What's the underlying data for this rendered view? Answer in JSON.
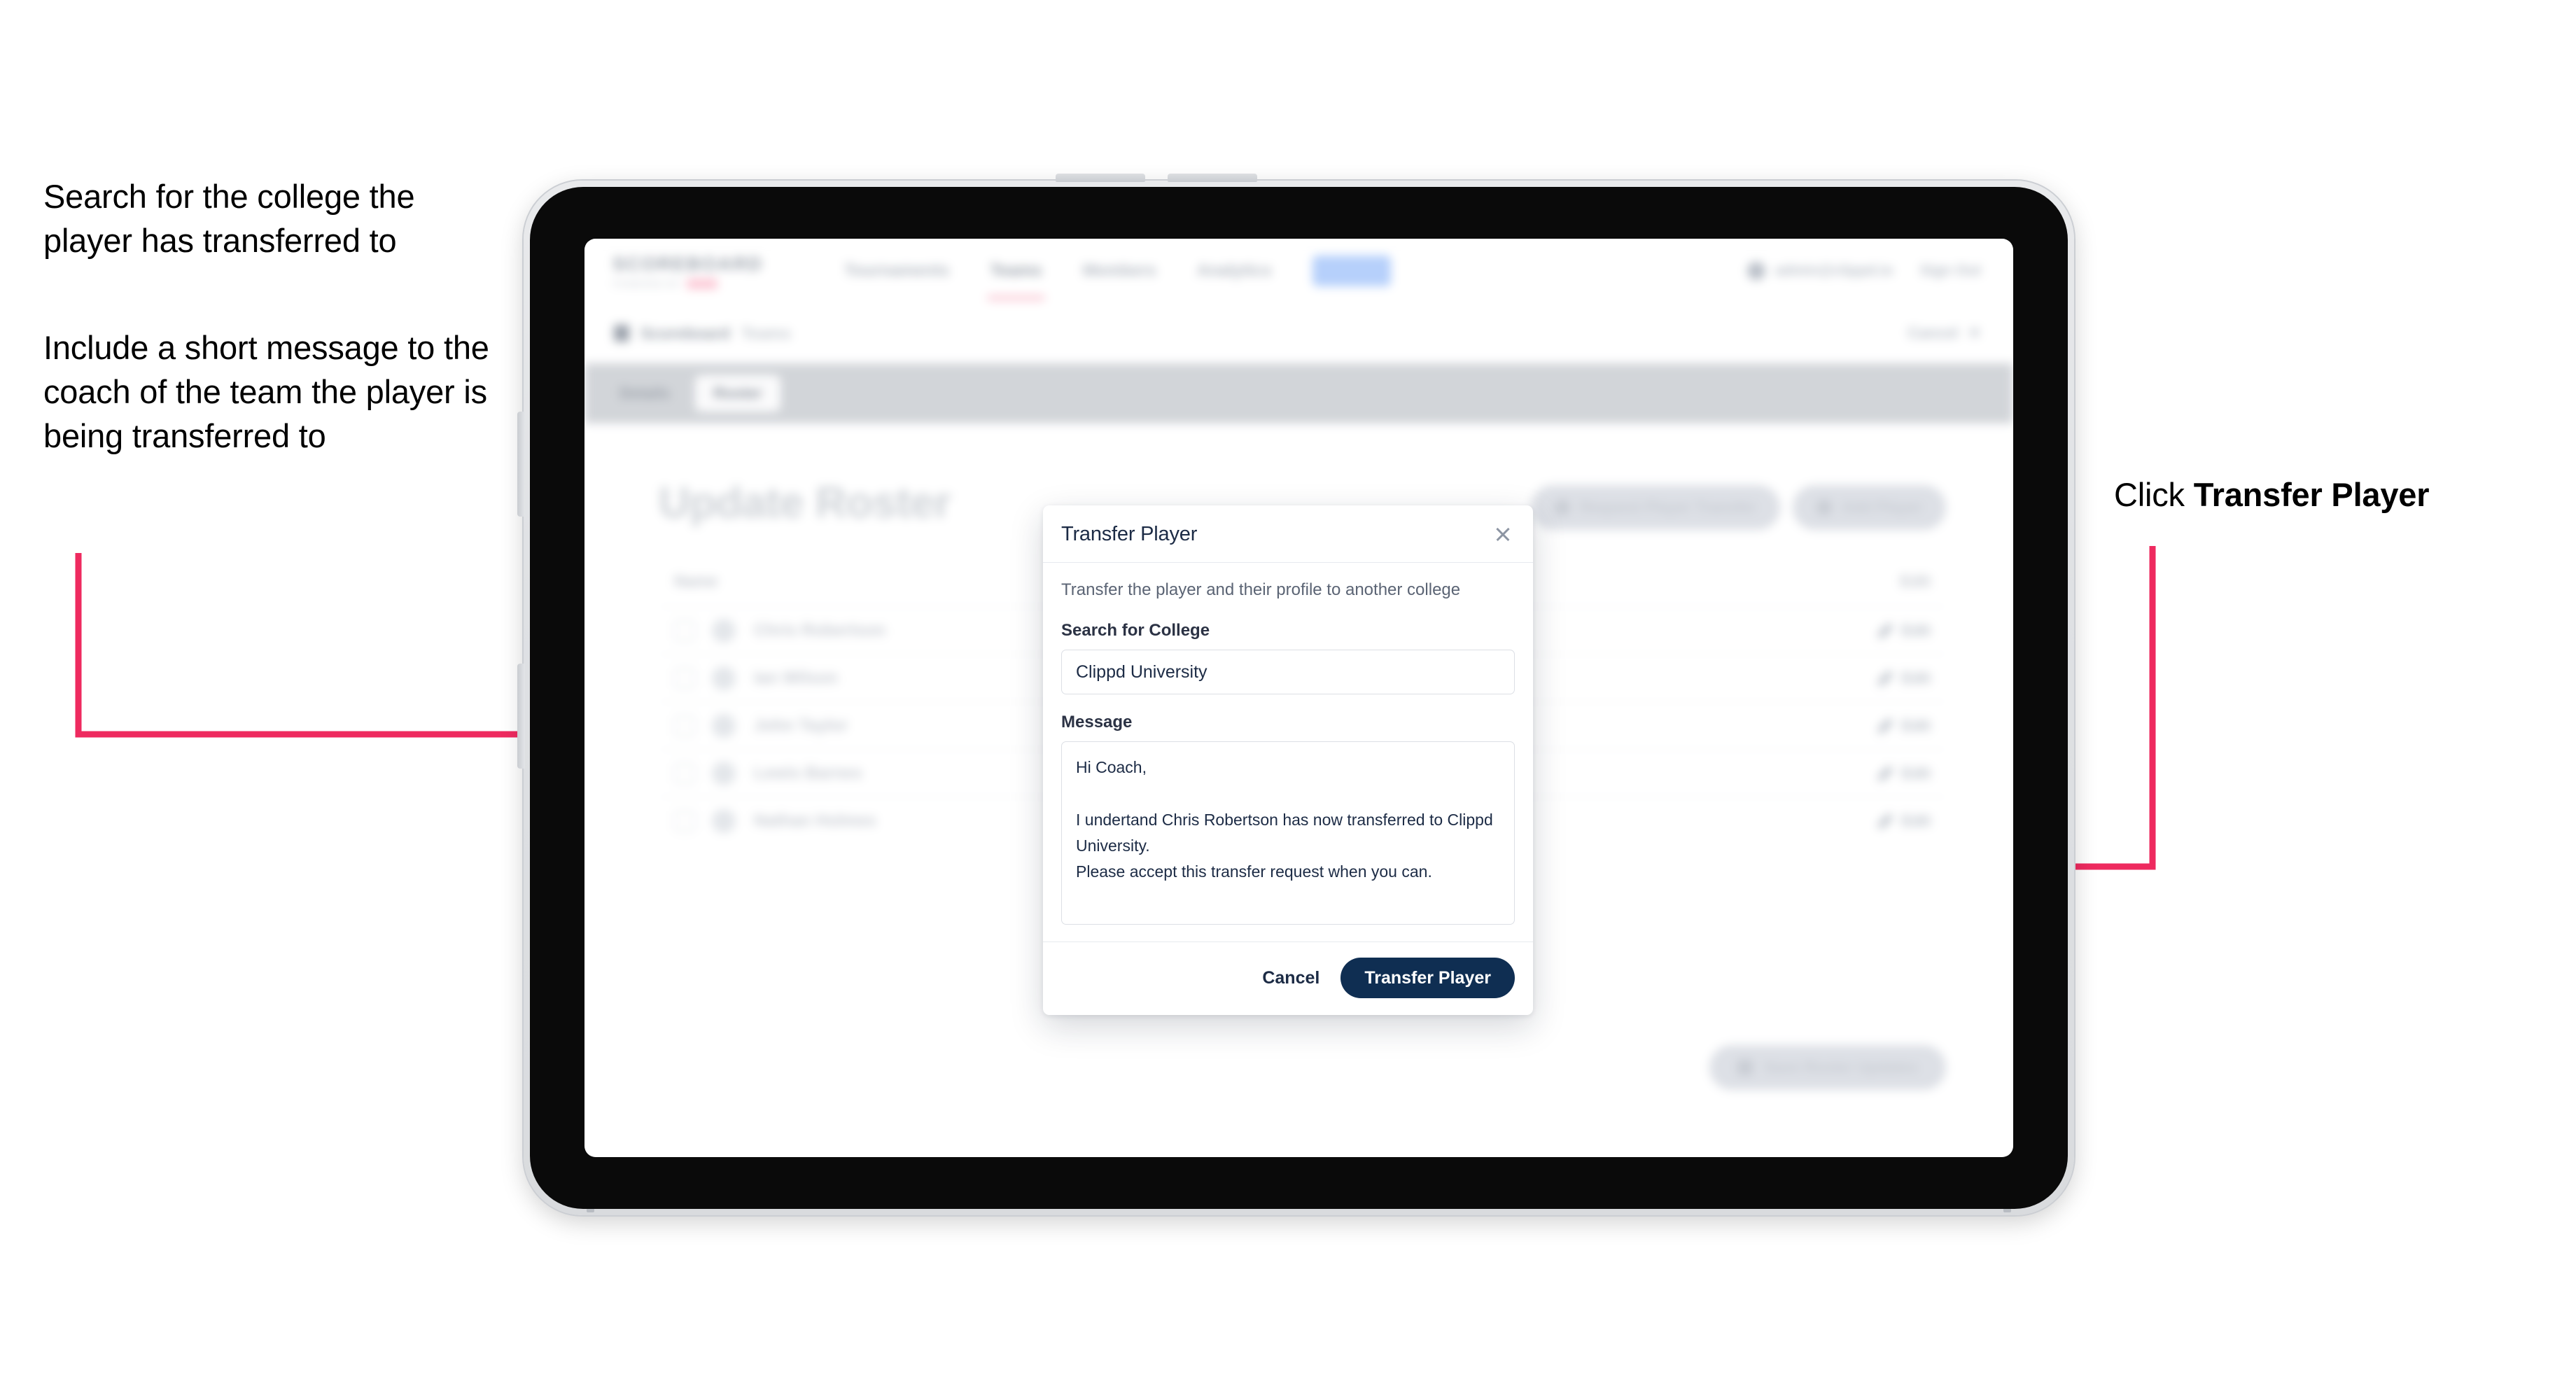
{
  "annotations": {
    "left_top": "Search for the college the player has transferred to",
    "left_bottom": "Include a short message to the coach of the team the player is being transferred to",
    "right_prefix": "Click ",
    "right_bold": "Transfer Player",
    "arrow_color": "#EE2A5F"
  },
  "app": {
    "logo": {
      "word": "SCOREBOARD",
      "sub": "POWERED BY"
    },
    "nav": [
      {
        "label": "Tournaments",
        "state": "normal"
      },
      {
        "label": "Teams",
        "state": "active"
      },
      {
        "label": "Members",
        "state": "normal"
      },
      {
        "label": "Analytics",
        "state": "normal"
      },
      {
        "label": "Admin",
        "state": "pill"
      }
    ],
    "nav_right": {
      "account": "admin@clippd.io",
      "signout": "Sign Out"
    },
    "breadcrumb": {
      "primary": "Scoreboard",
      "secondary": "Teams"
    },
    "subbar_right": "Cancel",
    "tabs": [
      {
        "label": "Details",
        "selected": false
      },
      {
        "label": "Roster",
        "selected": true
      }
    ],
    "page_title": "Update Roster",
    "action_buttons": [
      {
        "label": "Request Player Transfer",
        "icon": "transfer-icon"
      },
      {
        "label": "Add Player",
        "icon": "plus-icon"
      }
    ],
    "list_headers": {
      "name": "Name",
      "action": "Edit"
    },
    "players": [
      {
        "name": "Chris Robertson",
        "edit": "Edit"
      },
      {
        "name": "Ian Wilson",
        "edit": "Edit"
      },
      {
        "name": "John Taylor",
        "edit": "Edit"
      },
      {
        "name": "Lewis Barnes",
        "edit": "Edit"
      },
      {
        "name": "Nathan Holmes",
        "edit": "Edit"
      }
    ],
    "bottom_button": {
      "label": "Save Roster Updates",
      "icon": "save-icon"
    }
  },
  "modal": {
    "title": "Transfer Player",
    "close_icon": "close-icon",
    "subtitle": "Transfer the player and their profile to another college",
    "college_label": "Search for College",
    "college_value": "Clippd University",
    "message_label": "Message",
    "message_value": "Hi Coach,\n\nI undertand Chris Robertson has now transferred to Clippd University.\nPlease accept this transfer request when you can.",
    "cancel_label": "Cancel",
    "submit_label": "Transfer Player",
    "primary_color": "#0F2E52"
  }
}
